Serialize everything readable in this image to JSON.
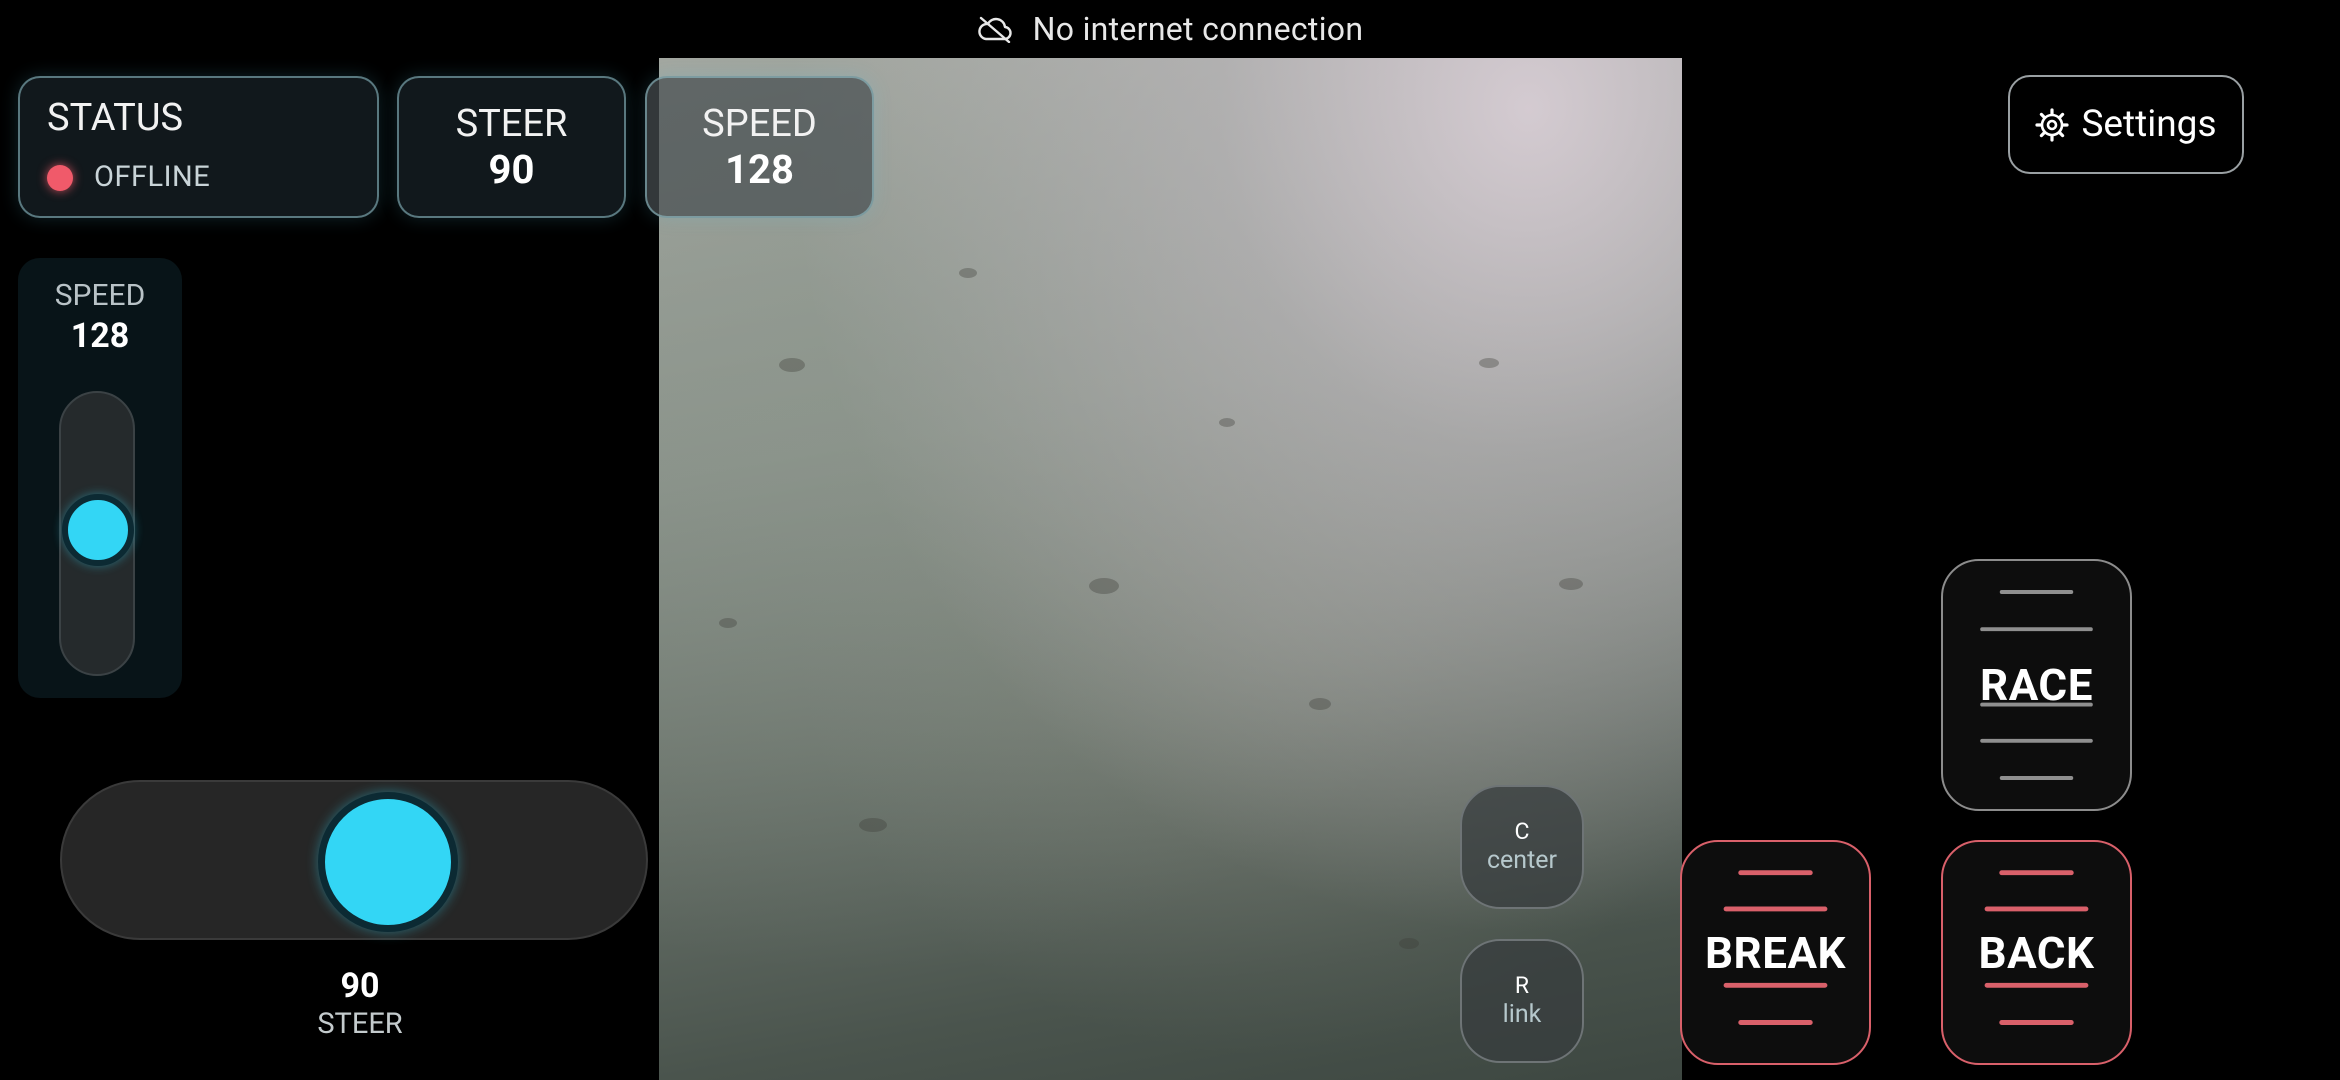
{
  "banner": {
    "text": "No internet connection",
    "icon": "cloud-off-icon"
  },
  "status": {
    "title": "STATUS",
    "state": "OFFLINE",
    "state_color": "#f05a6a"
  },
  "steer_card": {
    "label": "STEER",
    "value": "90"
  },
  "speed_card": {
    "label": "SPEED",
    "value": "128"
  },
  "settings": {
    "label": "Settings",
    "icon": "gear-icon"
  },
  "speed_slider": {
    "label": "SPEED",
    "value": "128",
    "level": 0.5
  },
  "steer_slider": {
    "value": "90",
    "label": "STEER",
    "level": 0.5
  },
  "mini_buttons": {
    "center": {
      "key": "C",
      "caption": "center"
    },
    "link": {
      "key": "R",
      "caption": "link"
    }
  },
  "actions": {
    "race": "RACE",
    "break": "BREAK",
    "back": "BACK"
  },
  "colors": {
    "accent": "#33d6f5",
    "danger": "#d9606a",
    "offline": "#f05a6a"
  }
}
